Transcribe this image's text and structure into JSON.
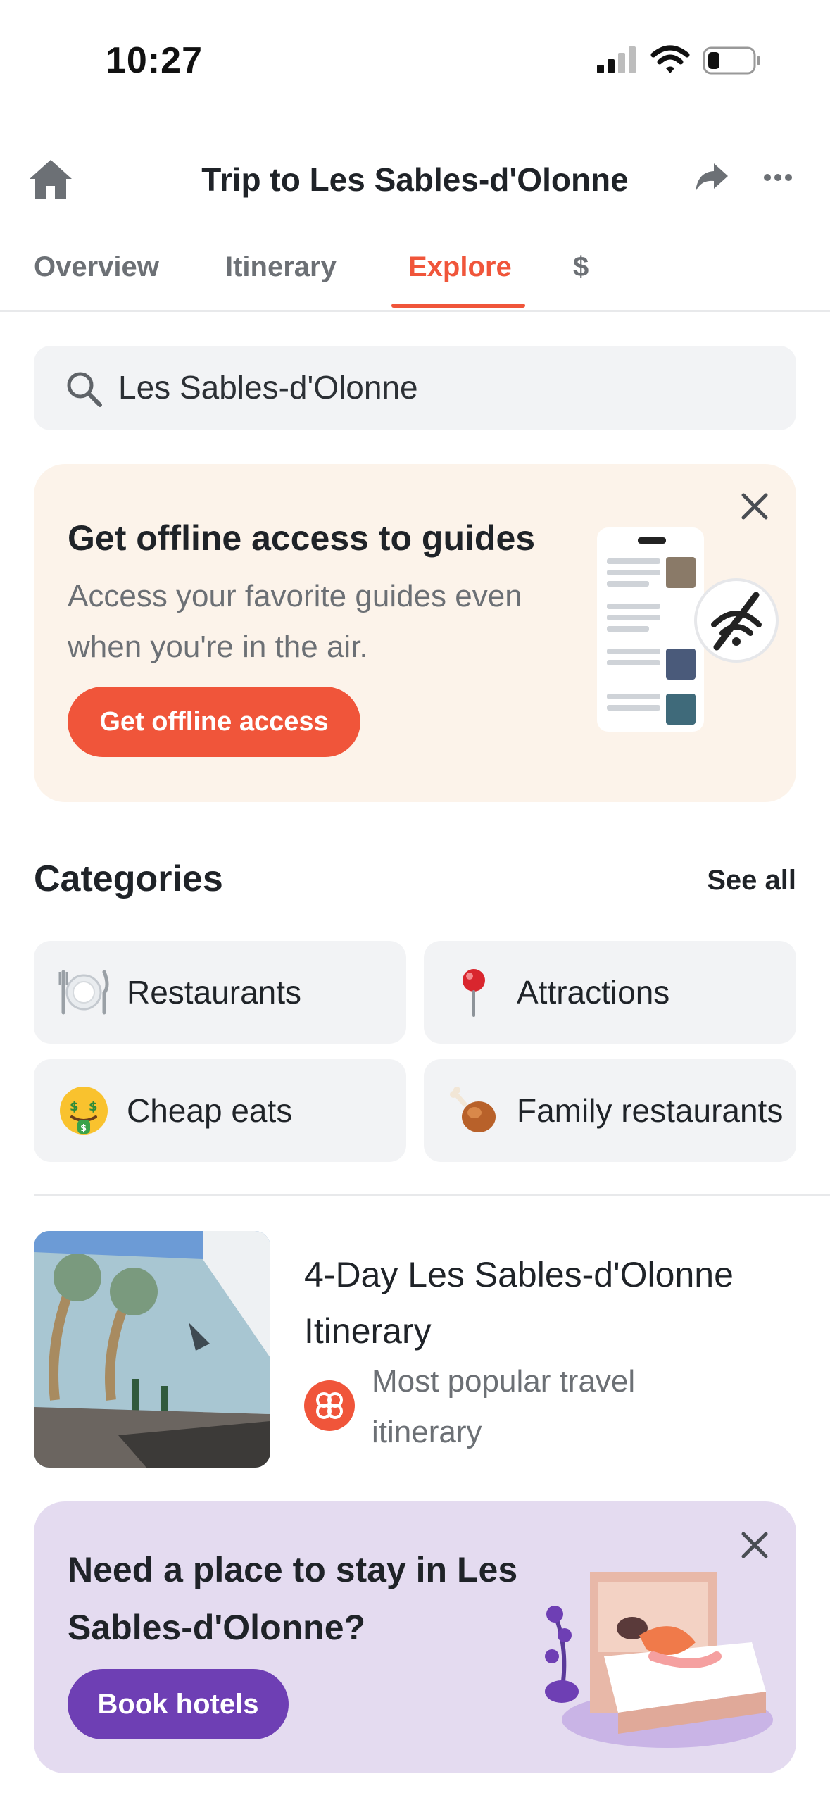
{
  "status_bar": {
    "time": "10:27"
  },
  "header": {
    "title": "Trip to Les Sables-d'Olonne"
  },
  "tabs": [
    {
      "label": "Overview",
      "active": false
    },
    {
      "label": "Itinerary",
      "active": false
    },
    {
      "label": "Explore",
      "active": true
    },
    {
      "label": "$",
      "active": false
    }
  ],
  "search": {
    "value": "Les Sables-d'Olonne"
  },
  "offline_banner": {
    "title": "Get offline access to guides",
    "body": "Access your favorite guides even when you're in the air.",
    "button_label": "Get offline access"
  },
  "categories": {
    "heading": "Categories",
    "see_all_label": "See all",
    "items": [
      {
        "label": "Restaurants",
        "icon": "plate-cutlery-icon"
      },
      {
        "label": "Attractions",
        "icon": "map-pin-icon"
      },
      {
        "label": "Cheap eats",
        "icon": "money-mouth-face-icon"
      },
      {
        "label": "Family restaurants",
        "icon": "poultry-leg-icon"
      }
    ]
  },
  "guide": {
    "title": "4-Day Les Sables-d'Olonne Itinerary",
    "subtitle": "Most popular travel itinerary"
  },
  "hotel_banner": {
    "title": "Need a place to stay in Les Sables-d'Olonne?",
    "button_label": "Book hotels"
  },
  "colors": {
    "accent": "#f0553a",
    "offline_bg": "#fcf3ea",
    "hotel_bg": "#e4dbf0",
    "hotel_button": "#6e3fb4",
    "chip_bg": "#f2f3f5"
  }
}
